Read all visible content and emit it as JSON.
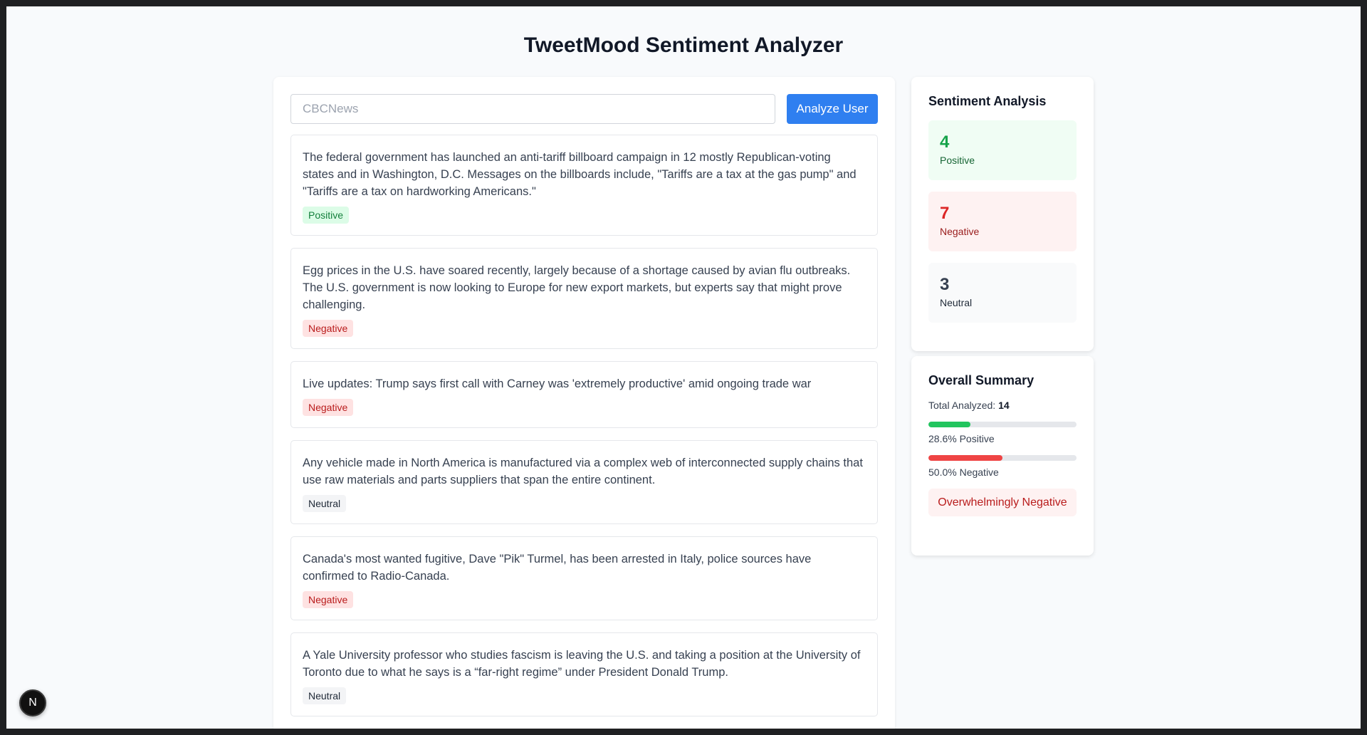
{
  "header": {
    "title": "TweetMood Sentiment Analyzer"
  },
  "search": {
    "placeholder": "CBCNews",
    "value": "",
    "button_label": "Analyze User"
  },
  "tweets": [
    {
      "text": "The federal government has launched an anti-tariff billboard campaign in 12 mostly Republican-voting states and in Washington, D.C. Messages on the billboards include, \"Tariffs are a tax at the gas pump\" and \"Tariffs are a tax on hardworking Americans.\"",
      "sentiment": "Positive"
    },
    {
      "text": "Egg prices in the U.S. have soared recently, largely because of a shortage caused by avian flu outbreaks. The U.S. government is now looking to Europe for new export markets, but experts say that might prove challenging.",
      "sentiment": "Negative"
    },
    {
      "text": "Live updates: Trump says first call with Carney was 'extremely productive' amid ongoing trade war",
      "sentiment": "Negative"
    },
    {
      "text": "Any vehicle made in North America is manufactured via a complex web of interconnected supply chains that use raw materials and parts suppliers that span the entire continent.",
      "sentiment": "Neutral"
    },
    {
      "text": "Canada's most wanted fugitive, Dave \"Pik\" Turmel, has been arrested in Italy, police sources have confirmed to Radio-Canada.",
      "sentiment": "Negative"
    },
    {
      "text": "A Yale University professor who studies fascism is leaving the U.S. and taking a position at the University of Toronto due to what he says is a “far-right regime” under President Donald Trump.",
      "sentiment": "Neutral"
    }
  ],
  "sentiment_analysis": {
    "title": "Sentiment Analysis",
    "positive": {
      "count": "4",
      "label": "Positive"
    },
    "negative": {
      "count": "7",
      "label": "Negative"
    },
    "neutral": {
      "count": "3",
      "label": "Neutral"
    }
  },
  "overall_summary": {
    "title": "Overall Summary",
    "total_label": "Total Analyzed:",
    "total_value": "14",
    "positive_pct": 28.6,
    "positive_label": "28.6% Positive",
    "negative_pct": 50.0,
    "negative_label": "50.0% Negative",
    "verdict": "Overwhelmingly Negative"
  },
  "dev_badge": {
    "letter": "N"
  },
  "colors": {
    "accent": "#2f7ff0",
    "positive": "#22c55e",
    "negative": "#ef4444"
  }
}
